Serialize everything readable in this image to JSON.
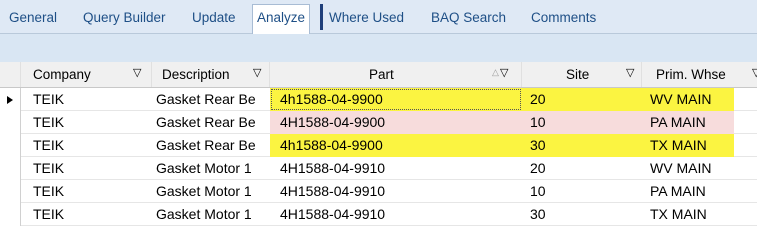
{
  "tabs": [
    {
      "label": "General",
      "active": false
    },
    {
      "label": "Query Builder",
      "active": false
    },
    {
      "label": "Update",
      "active": false
    },
    {
      "label": "Analyze",
      "active": true
    },
    {
      "label": "Where Used",
      "active": false
    },
    {
      "label": "BAQ Search",
      "active": false
    },
    {
      "label": "Comments",
      "active": false
    }
  ],
  "grid": {
    "columns": [
      {
        "label": "Company",
        "filter_icon": "filter-icon"
      },
      {
        "label": "Description",
        "filter_icon": "filter-icon"
      },
      {
        "label": "Part",
        "filter_icon": "filter-icon",
        "sort_icon": "sort-ascending-icon"
      },
      {
        "label": "Site",
        "filter_icon": "filter-icon"
      },
      {
        "label": "Prim. Whse",
        "filter_icon": "filter-icon"
      }
    ],
    "rows": [
      {
        "company": "TEIK",
        "description": "Gasket Rear Be",
        "part": "4h1588-04-9900",
        "site": "20",
        "whse": "WV MAIN",
        "highlight": "yellow",
        "current": true
      },
      {
        "company": "TEIK",
        "description": "Gasket Rear Be",
        "part": "4H1588-04-9900",
        "site": "10",
        "whse": "PA MAIN",
        "highlight": "pink",
        "current": false
      },
      {
        "company": "TEIK",
        "description": "Gasket Rear Be",
        "part": "4h1588-04-9900",
        "site": "30",
        "whse": "TX MAIN",
        "highlight": "yellow",
        "current": false
      },
      {
        "company": "TEIK",
        "description": "Gasket Motor 1",
        "part": "4H1588-04-9910",
        "site": "20",
        "whse": "WV MAIN",
        "highlight": "none",
        "current": false
      },
      {
        "company": "TEIK",
        "description": "Gasket Motor 1",
        "part": "4H1588-04-9910",
        "site": "10",
        "whse": "PA MAIN",
        "highlight": "none",
        "current": false
      },
      {
        "company": "TEIK",
        "description": "Gasket Motor 1",
        "part": "4H1588-04-9910",
        "site": "30",
        "whse": "TX MAIN",
        "highlight": "none",
        "current": false
      }
    ]
  },
  "colors": {
    "tab_text": "#1e4f86",
    "highlight_yellow": "#fbf441",
    "highlight_pink": "#f7dcdc",
    "tab_strip": "#dfe9f5"
  }
}
